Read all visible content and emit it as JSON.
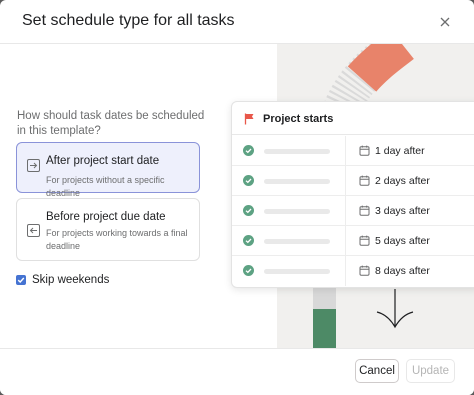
{
  "dialog": {
    "title": "Set schedule type for all tasks"
  },
  "form": {
    "question": "How should task dates be scheduled in this template?",
    "options": [
      {
        "title": "After project start date",
        "description": "For projects without a specific deadline",
        "selected": true
      },
      {
        "title": "Before project due date",
        "description": "For projects working towards a final deadline",
        "selected": false
      }
    ],
    "skip_weekends": {
      "label": "Skip weekends",
      "checked": true
    }
  },
  "preview": {
    "header": "Project starts",
    "rows": [
      {
        "offset": "1 day after"
      },
      {
        "offset": "2 days after"
      },
      {
        "offset": "3 days after"
      },
      {
        "offset": "5 days after"
      },
      {
        "offset": "8 days after"
      }
    ]
  },
  "footer": {
    "cancel_label": "Cancel",
    "update_label": "Update"
  },
  "colors": {
    "accent": "#4573d2",
    "selected_bg": "#eef0fc",
    "check_green": "#5da283",
    "flag_red": "#e8574a",
    "illus_orange": "#e8836a",
    "illus_green": "#4d8a66"
  }
}
